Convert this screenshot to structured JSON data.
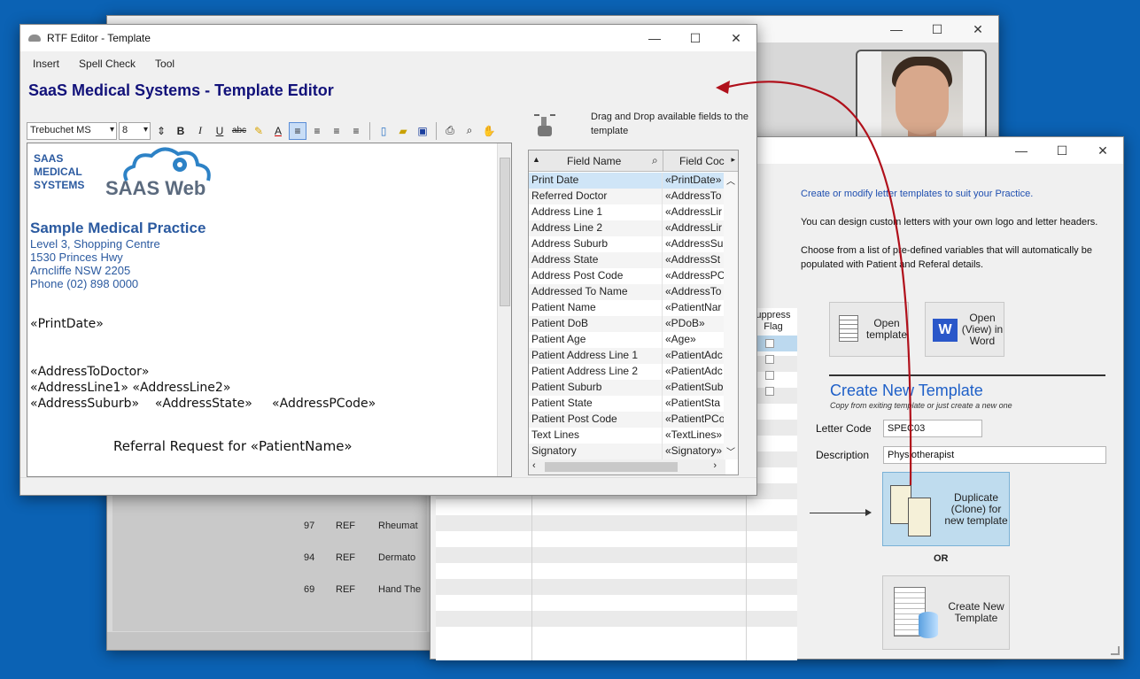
{
  "rtf_window": {
    "title": "RTF Editor - Template",
    "menu": [
      "Insert",
      "Spell Check",
      "Tool"
    ],
    "app_title": "SaaS Medical Systems - Template Editor",
    "font_name": "Trebuchet MS",
    "font_size": "8",
    "drag_hint": "Drag and Drop available fields to the template",
    "fields_header": {
      "name": "Field Name",
      "code": "Field Coc"
    },
    "fields": [
      {
        "name": "Print Date",
        "code": "«PrintDate»"
      },
      {
        "name": "Referred Doctor",
        "code": "«AddressTo"
      },
      {
        "name": "Address Line 1",
        "code": "«AddressLir"
      },
      {
        "name": "Address Line 2",
        "code": "«AddressLir"
      },
      {
        "name": "Address Suburb",
        "code": "«AddressSu"
      },
      {
        "name": "Address State",
        "code": "«AddressSt"
      },
      {
        "name": "Address Post Code",
        "code": "«AddressPC"
      },
      {
        "name": "Addressed To Name",
        "code": "«AddressTo"
      },
      {
        "name": "Patient Name",
        "code": "«PatientNar"
      },
      {
        "name": "Patient DoB",
        "code": "«PDoB»"
      },
      {
        "name": "Patient Age",
        "code": "«Age»"
      },
      {
        "name": "Patient Address Line 1",
        "code": "«PatientAdc"
      },
      {
        "name": "Patient Address Line 2",
        "code": "«PatientAdc"
      },
      {
        "name": "Patient Suburb",
        "code": "«PatientSub"
      },
      {
        "name": "Patient State",
        "code": "«PatientSta"
      },
      {
        "name": "Patient Post Code",
        "code": "«PatientPCo"
      },
      {
        "name": "Text Lines",
        "code": "«TextLines»"
      },
      {
        "name": "Signatory",
        "code": "«Signatory»"
      }
    ]
  },
  "document": {
    "logo_lines": [
      "SAAS",
      "MEDICAL",
      "SYSTEMS"
    ],
    "logo_word": "SAAS Web",
    "practice_name": "Sample Medical Practice",
    "address": [
      "Level 3, Shopping Centre",
      "1530 Princes Hwy",
      "Arncliffe NSW 2205",
      "Phone (02) 898 0000"
    ],
    "print_date": "«PrintDate»",
    "to_doctor": "«AddressToDoctor»",
    "line1": "«AddressLine1»  «AddressLine2»",
    "line2": "«AddressSuburb»    «AddressState»     «AddressPCode»",
    "heading": "Referral Request for «PatientName»"
  },
  "right_window": {
    "intro1": "Create or modify letter templates to suit your Practice.",
    "intro2": "You can design custom letters with your own logo and letter headers.",
    "intro3": "Choose from a list of pre-defined variables that will automatically be populated with Patient and Referal details.",
    "suppress_header": "uppress Flag",
    "open_template": "Open template",
    "open_view": "Open (View) in Word",
    "create_title": "Create New Template",
    "create_sub": "Copy from exiting template or just create a new one",
    "letter_code_label": "Letter Code",
    "letter_code": "SPEC03",
    "description_label": "Description",
    "description": "Physiotherapist",
    "duplicate": "Duplicate (Clone) for new template",
    "or": "OR",
    "create_new": "Create New Template"
  },
  "back_window": {
    "rows": [
      {
        "id": "97",
        "type": "REF",
        "name": "Rheumat"
      },
      {
        "id": "94",
        "type": "REF",
        "name": "Dermato"
      },
      {
        "id": "69",
        "type": "REF",
        "name": "Hand The"
      }
    ]
  },
  "colors": {
    "desktop": "#0b62b4",
    "accent_arrow": "#b0101b",
    "title_blue": "#12127a",
    "create_blue": "#1f60c8"
  }
}
